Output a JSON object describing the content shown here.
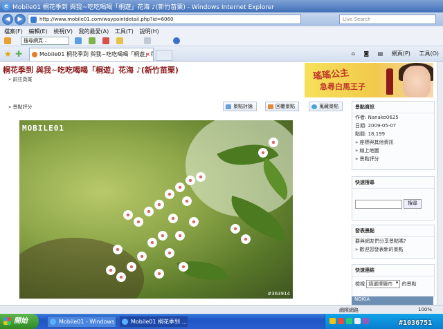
{
  "window": {
    "title": "Mobile01 桐花季到 與我~吃吃喝喝「桐遊」花海 ♪(新竹苗栗) - Windows Internet Explorer"
  },
  "address": {
    "url": "http://www.mobile01.com/waypointdetail.php?id=6060",
    "search_placeholder": "Live Search"
  },
  "menu": [
    "檔案(F)",
    "編輯(E)",
    "檢視(V)",
    "我的最愛(A)",
    "工具(T)",
    "說明(H)"
  ],
  "toolbar": {
    "search_placeholder": "搜尋網頁..."
  },
  "tabs": {
    "active": "Mobile01 桐花季到 與我~吃吃喝喝「桐遊」花海 ♪"
  },
  "command_bar": {
    "page": "網頁(P)",
    "tools": "工具(O)"
  },
  "page": {
    "title": "桐花季到 與我~吃吃喝喝「桐遊」花海 ♪(新竹苗栗)",
    "breadcrumb": "» 前往頁尾",
    "rating_label": "» 景點評分",
    "banner_line1": "瑤瑤公主",
    "banner_line2": "急尋白馬王子",
    "actions": {
      "discuss": "景點討論",
      "reply": "回覆景點",
      "collect": "蒐藏景點"
    },
    "photo": {
      "logo": "MOBILE01",
      "id": "#363914"
    }
  },
  "sidebar": {
    "info": {
      "title": "景點資訊",
      "author": "作者: Nanako0625",
      "date": "日期: 2009-05-07",
      "views": "點閱: 18,199",
      "links": [
        "» 座標與其他資訊",
        "» 線上地圖",
        "» 景點評分"
      ]
    },
    "quick_search": {
      "title": "快速搜尋",
      "button": "搜尋"
    },
    "publish": {
      "title": "發表景點",
      "line1": "要與網友們分享景點嗎?",
      "line2": "» 歡迎您發表新的景點"
    },
    "quick_links": {
      "title": "快速連結",
      "label": "檢視",
      "select": "請選擇縣市",
      "suffix": "的景點"
    },
    "ad": "NOKIA"
  },
  "status": {
    "zone": "網際網路",
    "zoom": "100%"
  },
  "taskbar": {
    "start": "開始",
    "tasks": [
      "Mobile01 - Windows I...",
      "Mobile01 桐花季到 ..."
    ],
    "watermark": "#1036751"
  }
}
